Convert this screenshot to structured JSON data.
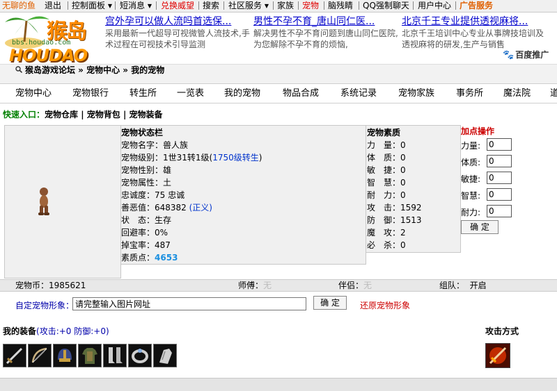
{
  "topnav": {
    "items": [
      "无聊的鱼",
      "退出",
      "控制面板",
      "短消息",
      "兑换威望",
      "搜索",
      "社区服务",
      "家族",
      "宠物",
      "脑残睛",
      "QQ强制聊天",
      "用户中心",
      "广告服务"
    ]
  },
  "logo": {
    "cn": "猴岛",
    "url": "bbs.houdao.com",
    "en": "HOUDAO"
  },
  "ads": [
    {
      "title": "宫外孕可以做人流吗首选保...",
      "desc": "采用最新一代超导可视微管人流技术,手术过程在可视技术引导监测"
    },
    {
      "title": "男性不孕不育_唐山同仁医...",
      "desc": "解决男性不孕不育问题到唐山同仁医院,为您解除不孕不育的烦恼,"
    },
    {
      "title": "北京千王专业提供透视麻将...",
      "desc": "北京千王培训中心专业从事牌技培训及透视麻将的研发,生产与销售"
    }
  ],
  "baidu": "百度推广",
  "breadcrumb": "猴岛游戏论坛 » 宠物中心 » 我的宠物",
  "menu": [
    "宠物中心",
    "宠物银行",
    "转生所",
    "一览表",
    "我的宠物",
    "物品合成",
    "系统记录",
    "宠物家族",
    "事务所",
    "魔法院",
    "道"
  ],
  "quick": {
    "label": "快速入口：",
    "links": [
      "宠物仓库",
      "宠物背包",
      "宠物装备"
    ]
  },
  "status": {
    "header": "宠物状态栏",
    "name": "宠物名字：兽人族",
    "level_prefix": "宠物级别：1世31转1级(",
    "level_link": "1750级转生",
    "level_suffix": ")",
    "gender": "宠物性别：雄",
    "attribute": "宠物属性：土",
    "loyalty": "忠诚度：75 忠诚",
    "karma_prefix": "善恶值：648382 ",
    "karma_link": "(正义)",
    "state": "状　态：生存",
    "evade": "回避率：0%",
    "drop": "掉宝率：487",
    "points_label": "素质点：",
    "points_value": "4653"
  },
  "quality": {
    "header": "宠物素质",
    "rows": [
      "力　量：0",
      "体　质：0",
      "敏　捷：0",
      "智　慧：0",
      "耐　力：0",
      "攻　击：1592",
      "防　御：1513",
      "魔　攻：2",
      "必　杀：0"
    ]
  },
  "add": {
    "header": "加点操作",
    "fields": [
      {
        "label": "力量:",
        "value": "0"
      },
      {
        "label": "体质:",
        "value": "0"
      },
      {
        "label": "敏捷:",
        "value": "0"
      },
      {
        "label": "智慧:",
        "value": "0"
      },
      {
        "label": "耐力:",
        "value": "0"
      }
    ],
    "confirm": "确 定"
  },
  "currency": {
    "coin": "宠物币：1985621",
    "master_label": "师傅：",
    "master_value": "无",
    "partner_label": "伴侣：",
    "partner_value": "无",
    "team_label": "组队：",
    "team_value": "开启"
  },
  "custom": {
    "label": "自定宠物形象：",
    "input_value": "请完整输入图片网址",
    "confirm": "确 定",
    "restore": "还原宠物形象"
  },
  "equipment": {
    "title": "我的装备",
    "stats": "(攻击:+0 防御:+0)",
    "items": [
      "sword-icon",
      "bow-icon",
      "helmet-icon",
      "armor-icon",
      "boots-icon",
      "ring-icon",
      "gauntlet-icon"
    ]
  },
  "attack": {
    "title": "攻击方式",
    "icon": "fire-sword-icon"
  },
  "colors": {
    "accent_red": "#cc0000",
    "link_blue": "#0000cc",
    "panel_grey": "#f0f0f0"
  }
}
